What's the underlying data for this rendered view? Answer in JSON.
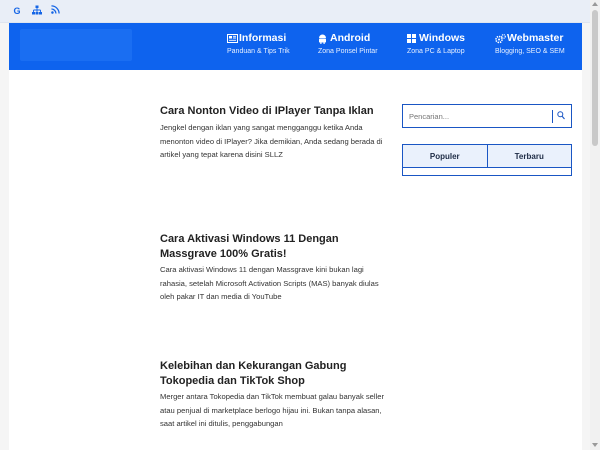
{
  "topbar": {
    "icons": [
      "google-icon",
      "sitemap-icon",
      "rss-icon"
    ],
    "google_glyph": "G"
  },
  "nav": [
    {
      "icon": "newspaper-icon",
      "title": "Informasi",
      "subtitle": "Panduan & Tips Trik"
    },
    {
      "icon": "android-icon",
      "title": "Android",
      "subtitle": "Zona Ponsel Pintar"
    },
    {
      "icon": "windows-icon",
      "title": "Windows",
      "subtitle": "Zona PC & Laptop"
    },
    {
      "icon": "cogs-icon",
      "title": "Webmaster",
      "subtitle": "Blogging, SEO & SEM"
    }
  ],
  "articles": [
    {
      "title": "Cara Nonton Video di IPlayer Tanpa Iklan",
      "desc": "Jengkel dengan iklan yang sangat mengganggu ketika Anda menonton video di IPlayer? Jika demikian, Anda sedang berada di artikel yang tepat karena disini SLLZ"
    },
    {
      "title": "Cara Aktivasi Windows 11 Dengan Massgrave 100% Gratis!",
      "desc": "Cara aktivasi Windows 11 dengan Massgrave kini bukan lagi rahasia, setelah Microsoft Activation Scripts (MAS) banyak diulas oleh pakar IT dan media di YouTube"
    },
    {
      "title": "Kelebihan dan Kekurangan Gabung Tokopedia dan TikTok Shop",
      "desc": "Merger antara Tokopedia dan TikTok membuat galau banyak seller atau penjual di marketplace berlogo hijau ini. Bukan tanpa alasan, saat artikel ini ditulis, penggabungan"
    }
  ],
  "sidebar": {
    "search_placeholder": "Pencarian...",
    "search_icon": "search-icon",
    "tabs": [
      "Populer",
      "Terbaru"
    ]
  },
  "colors": {
    "brand_blue": "#0e63ee",
    "accent_border": "#1a56c4",
    "topbar_bg": "#e9eef7"
  }
}
